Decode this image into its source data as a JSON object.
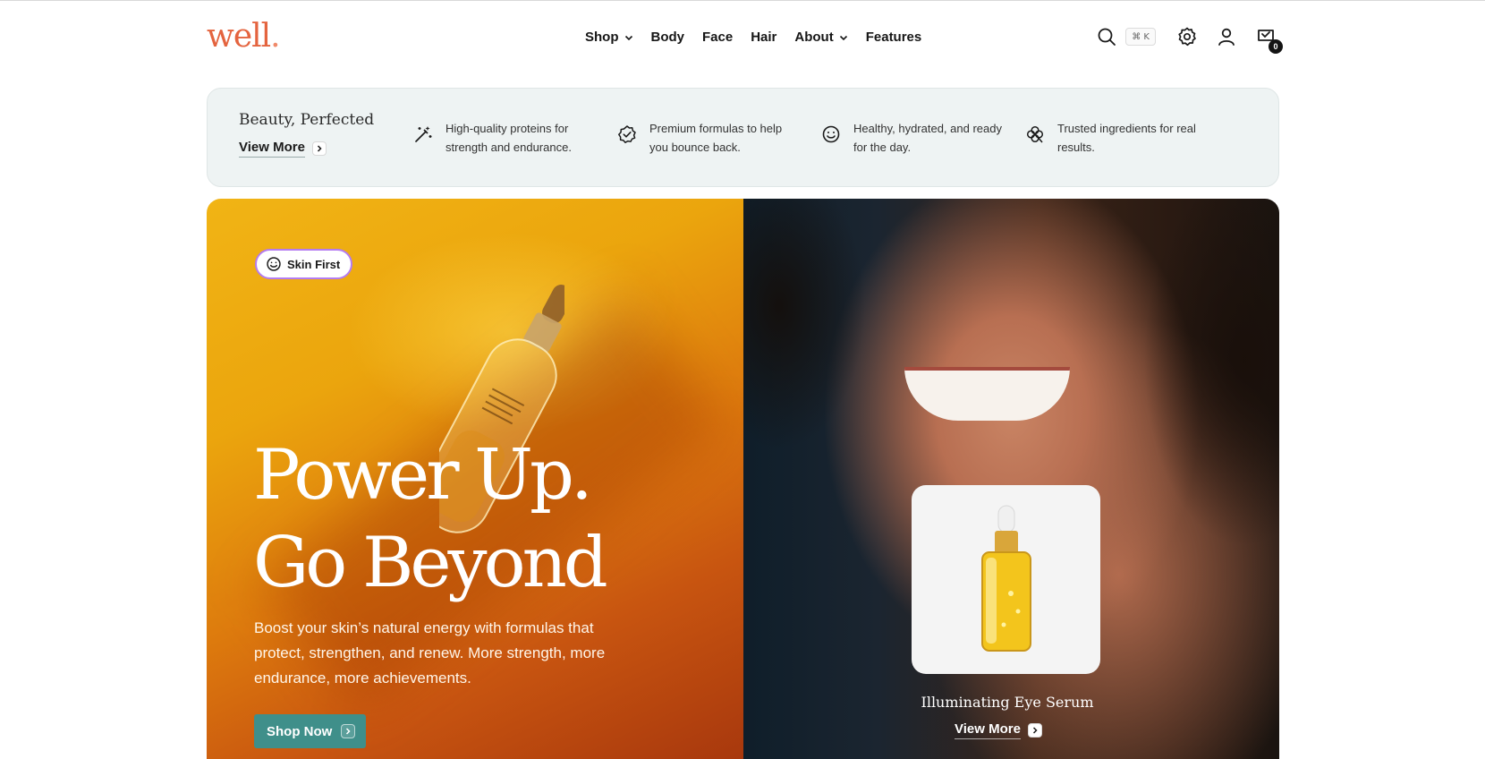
{
  "brand": {
    "logo_text": "well",
    "logo_dot": "."
  },
  "nav": {
    "items": [
      {
        "label": "Shop",
        "has_dropdown": true
      },
      {
        "label": "Body",
        "has_dropdown": false
      },
      {
        "label": "Face",
        "has_dropdown": false
      },
      {
        "label": "Hair",
        "has_dropdown": false
      },
      {
        "label": "About",
        "has_dropdown": true
      },
      {
        "label": "Features",
        "has_dropdown": false
      }
    ]
  },
  "header_tools": {
    "search_icon": "search-icon",
    "search_shortcut": "⌘ K",
    "settings_icon": "gear-icon",
    "account_icon": "user-icon",
    "cart_icon": "cart-icon",
    "cart_count": "0"
  },
  "features": {
    "title": "Beauty, Perfected",
    "link_label": "View More",
    "items": [
      {
        "icon": "magic-wand-icon",
        "text": "High-quality proteins for strength and endurance."
      },
      {
        "icon": "badge-check-icon",
        "text": "Premium formulas to help you bounce back."
      },
      {
        "icon": "smile-icon",
        "text": "Healthy, hydrated, and ready for the day."
      },
      {
        "icon": "clover-icon",
        "text": "Trusted ingredients for real results."
      }
    ]
  },
  "hero": {
    "badge": "Skin First",
    "headline_line1": "Power Up.",
    "headline_line2": "Go Beyond",
    "subtext": "Boost your skin’s natural energy with formulas that protect, strengthen, and renew. More strength, more endurance, more achievements.",
    "cta": "Shop Now",
    "product_name": "Illuminating Eye Serum",
    "product_link": "View More"
  },
  "colors": {
    "logo": "#e4643f",
    "feature_strip_bg": "#eef3f3",
    "cta_bg": "#3f8f8a",
    "hero_left_orange": "#eba50d",
    "badge_border": "#b47cf0"
  }
}
